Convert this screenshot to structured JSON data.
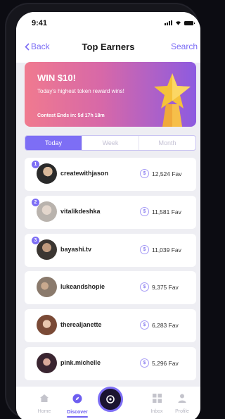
{
  "status_bar": {
    "time": "9:41"
  },
  "nav": {
    "back_label": "Back",
    "title": "Top Earners",
    "search_label": "Search"
  },
  "banner": {
    "headline": "WIN $10!",
    "subtitle": "Today's highest token reward wins!",
    "ends": "Contest Ends in: 5d 17h 18m"
  },
  "tabs": [
    {
      "label": "Today",
      "active": true
    },
    {
      "label": "Week",
      "active": false
    },
    {
      "label": "Month",
      "active": false
    }
  ],
  "leaderboard": [
    {
      "rank": "1",
      "username": "createwithjason",
      "score": "12,524 Fav"
    },
    {
      "rank": "2",
      "username": "vitalikdeshka",
      "score": "11,581 Fav"
    },
    {
      "rank": "3",
      "username": "bayashi.tv",
      "score": "11,039 Fav"
    },
    {
      "rank": "",
      "username": "lukeandshopie",
      "score": "9,375 Fav"
    },
    {
      "rank": "",
      "username": "therealjanette",
      "score": "6,283 Fav"
    },
    {
      "rank": "",
      "username": "pink.michelle",
      "score": "5,296 Fav"
    }
  ],
  "tab_bar": {
    "home_label": "Home",
    "discover_label": "Discover",
    "inbox_label": "Inbox",
    "profile_label": "Profile"
  },
  "colors": {
    "accent": "#7d6ef5",
    "banner_start": "#f07a8f",
    "banner_end": "#8d5be0",
    "star": "#f5c23a"
  },
  "icons": {
    "back": "chevron-left-icon",
    "coin": "token-coin-icon",
    "home": "home-icon",
    "discover": "compass-icon",
    "center": "create-icon",
    "inbox": "inbox-icon",
    "profile": "person-icon"
  }
}
